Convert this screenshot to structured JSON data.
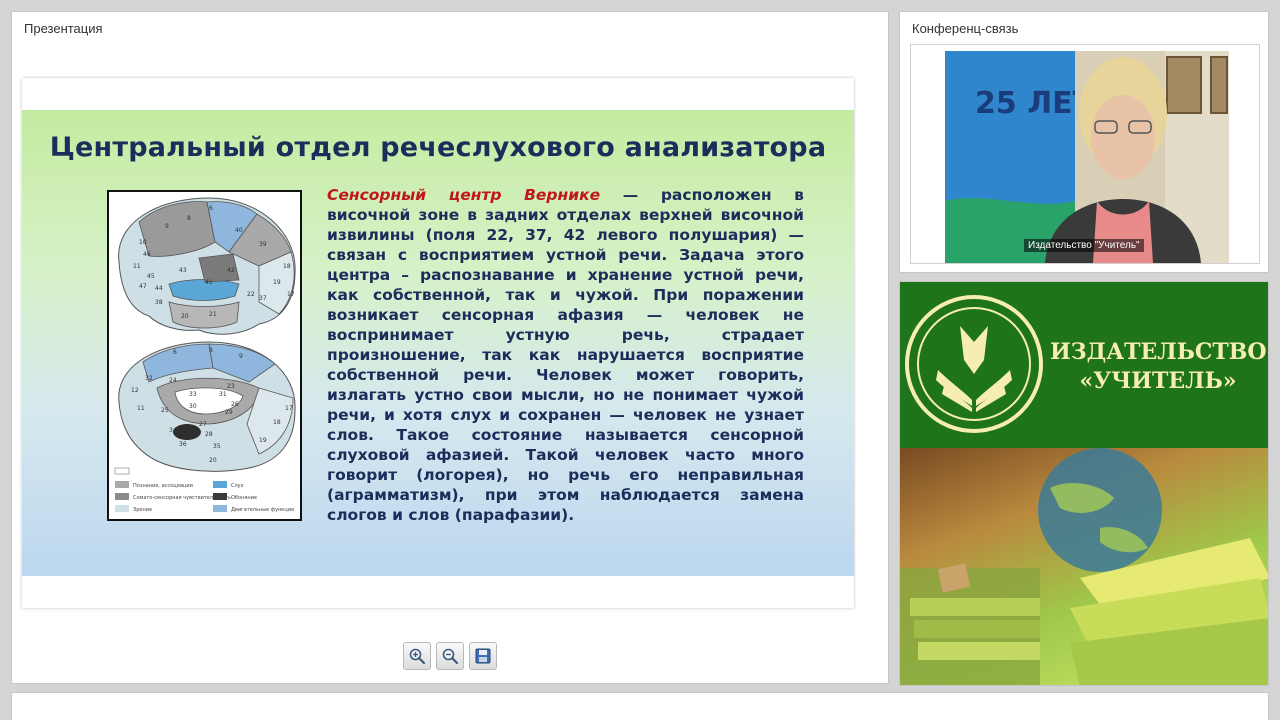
{
  "presentation": {
    "title": "Презентация",
    "slide": {
      "heading": "Центральный отдел речеслухового анализатора",
      "highlight": "Сенсорный центр Вернике",
      "body": " — расположен в височной зоне в задних отделах верхней височной извилины (поля 22, 37, 42 левого полушария) — связан с восприятием устной речи. Задача этого центра – распознавание и хранение устной речи, как собственной, так и чужой. При поражении возникает сенсорная афазия — человек не воспринимает устную речь, страдает произношение, так как нарушается восприятие собственной речи. Человек может говорить, излагать устно свои мысли, но не понимает чужой речи, и хотя слух и сохранен — человек не узнает слов. Такое состояние называется сенсорной слуховой афазией. Такой человек часто много говорит (логорея), но речь его неправильная (аграмматизм), при этом наблюдается замена слогов и слов (парафазии).",
      "diagram": {
        "field_numbers_top": [
          "6",
          "8",
          "9",
          "10",
          "11",
          "46",
          "45",
          "44",
          "43",
          "41",
          "42",
          "22",
          "21",
          "20",
          "37",
          "19",
          "18",
          "17",
          "38",
          "47",
          "39",
          "40"
        ],
        "field_numbers_bottom": [
          "6",
          "8",
          "9",
          "24",
          "32",
          "33",
          "31",
          "23",
          "26",
          "29",
          "30",
          "27",
          "28",
          "35",
          "36",
          "34",
          "25",
          "11",
          "12",
          "20",
          "19",
          "18",
          "17"
        ],
        "legend": [
          {
            "label": "Познание, ассоциации",
            "color": "#a9a9a9"
          },
          {
            "label": "Слух",
            "color": "#5aa6d6"
          },
          {
            "label": "Сомато-сенсорная чувствительность",
            "color": "#8a8a8a"
          },
          {
            "label": "Обоняние",
            "color": "#3a3a3a"
          },
          {
            "label": "Зрение",
            "color": "#cfe0e8"
          },
          {
            "label": "Двигательные функции",
            "color": "#8fb6dc"
          }
        ]
      }
    },
    "toolbar": {
      "zoom_in_icon": "zoom-in-icon",
      "zoom_out_icon": "zoom-out-icon",
      "save_icon": "save-icon"
    }
  },
  "conference": {
    "title": "Конференц-связь",
    "video_label": "Издательство \"Учитель\"",
    "backdrop_text": "25 ЛЕТ"
  },
  "publisher": {
    "name_line1": "ИЗДАТЕЛЬСТВО",
    "name_line2": "«УЧИТЕЛЬ»"
  },
  "colors": {
    "slide_title": "#1b2d5a",
    "highlight": "#c0171c",
    "publisher_green": "#1f7419",
    "publisher_text": "#f5eeb0"
  }
}
